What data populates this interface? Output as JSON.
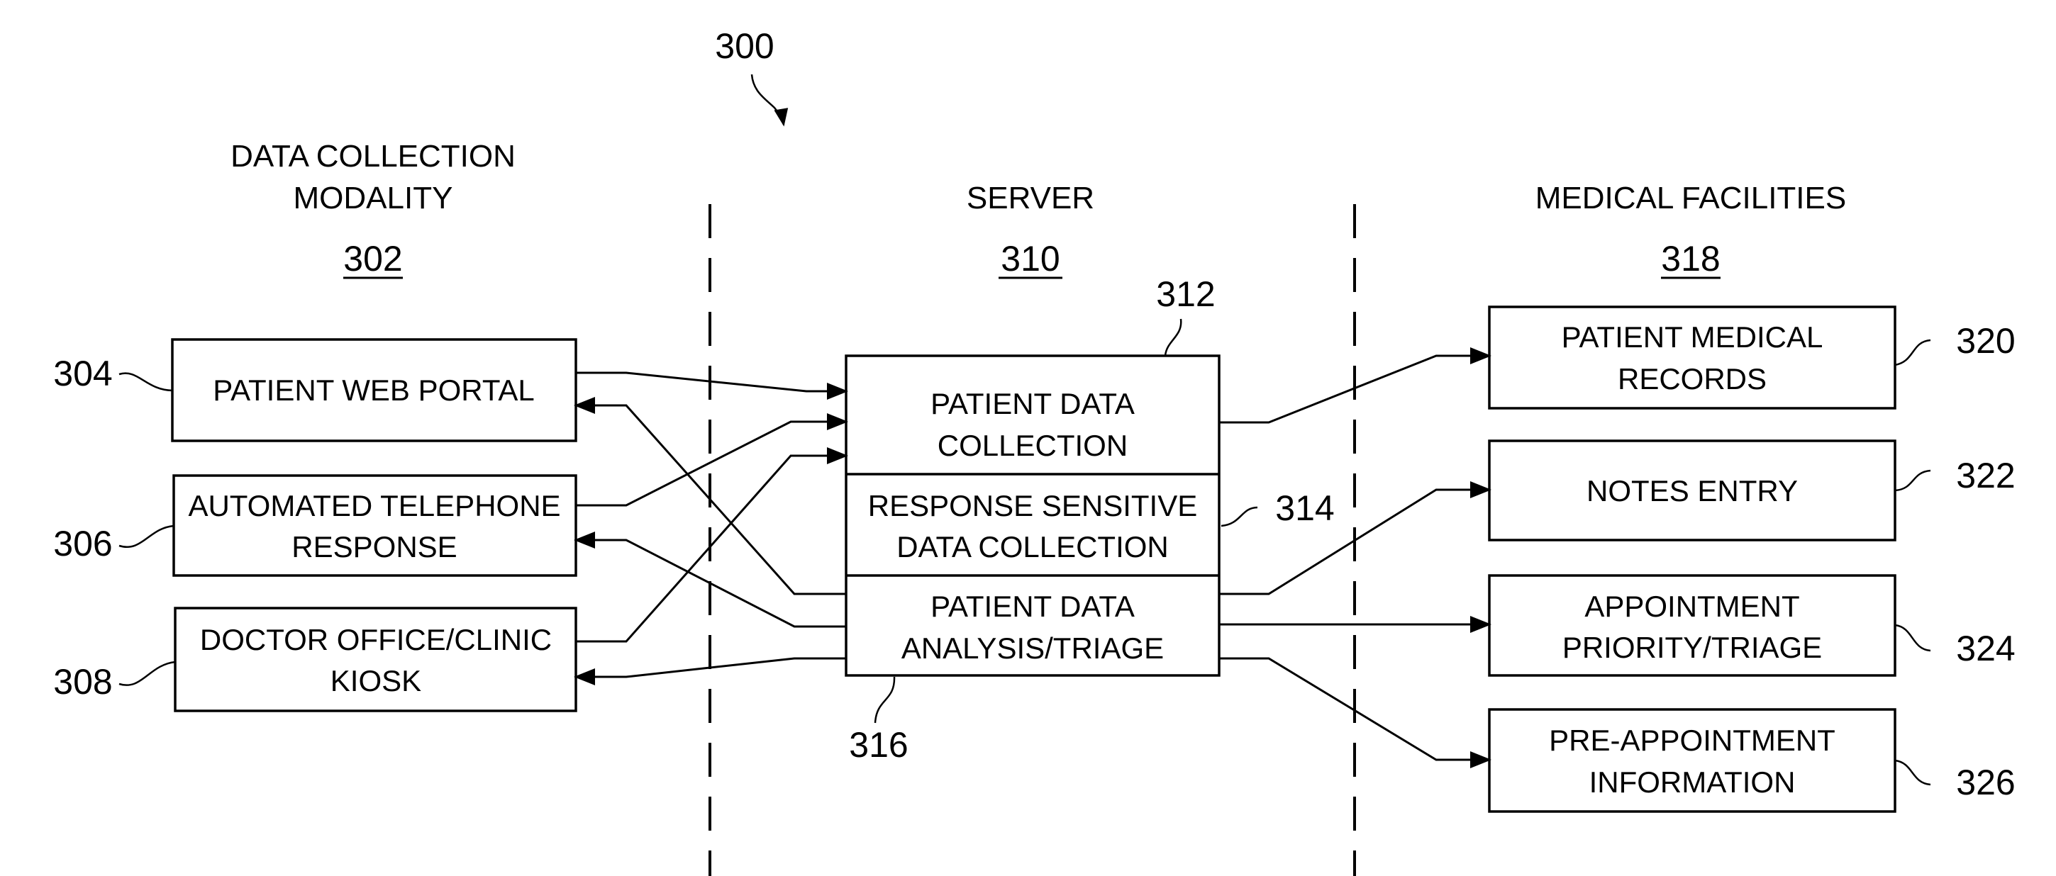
{
  "figure": {
    "ref": "300"
  },
  "columns": [
    {
      "id": "data-collection",
      "title_lines": [
        "DATA COLLECTION",
        "MODALITY"
      ],
      "ref": "302"
    },
    {
      "id": "server",
      "title_lines": [
        "SERVER"
      ],
      "ref": "310"
    },
    {
      "id": "medical-facilities",
      "title_lines": [
        "MEDICAL FACILITIES"
      ],
      "ref": "318"
    }
  ],
  "left_boxes": [
    {
      "id": "patient-web-portal",
      "lines": [
        "PATIENT WEB PORTAL"
      ],
      "ref": "304"
    },
    {
      "id": "automated-telephone-response",
      "lines": [
        "AUTOMATED TELEPHONE",
        "RESPONSE"
      ],
      "ref": "306"
    },
    {
      "id": "doctor-office-clinic-kiosk",
      "lines": [
        "DOCTOR OFFICE/CLINIC",
        "KIOSK"
      ],
      "ref": "308"
    }
  ],
  "server_sections": [
    {
      "id": "patient-data-collection",
      "lines": [
        "PATIENT DATA",
        "COLLECTION"
      ],
      "ref": "312"
    },
    {
      "id": "response-sensitive-data-collection",
      "lines": [
        "RESPONSE SENSITIVE",
        "DATA COLLECTION"
      ],
      "ref": "314"
    },
    {
      "id": "patient-data-analysis-triage",
      "lines": [
        "PATIENT DATA",
        "ANALYSIS/TRIAGE"
      ],
      "ref": "316"
    }
  ],
  "right_boxes": [
    {
      "id": "patient-medical-records",
      "lines": [
        "PATIENT MEDICAL",
        "RECORDS"
      ],
      "ref": "320"
    },
    {
      "id": "notes-entry",
      "lines": [
        "NOTES ENTRY"
      ],
      "ref": "322"
    },
    {
      "id": "appointment-priority-triage",
      "lines": [
        "APPOINTMENT",
        "PRIORITY/TRIAGE"
      ],
      "ref": "324"
    },
    {
      "id": "pre-appointment-information",
      "lines": [
        "PRE-APPOINTMENT",
        "INFORMATION"
      ],
      "ref": "326"
    }
  ],
  "connections": [
    {
      "from": "patient-web-portal",
      "to": "patient-data-collection"
    },
    {
      "from": "patient-data-analysis-triage",
      "to": "patient-web-portal"
    },
    {
      "from": "automated-telephone-response",
      "to": "patient-data-collection"
    },
    {
      "from": "patient-data-analysis-triage",
      "to": "automated-telephone-response"
    },
    {
      "from": "doctor-office-clinic-kiosk",
      "to": "patient-data-collection"
    },
    {
      "from": "patient-data-analysis-triage",
      "to": "doctor-office-clinic-kiosk"
    },
    {
      "from": "patient-data-collection",
      "to": "patient-medical-records"
    },
    {
      "from": "patient-data-analysis-triage",
      "to": "notes-entry"
    },
    {
      "from": "patient-data-analysis-triage",
      "to": "appointment-priority-triage"
    },
    {
      "from": "patient-data-analysis-triage",
      "to": "pre-appointment-information"
    }
  ]
}
